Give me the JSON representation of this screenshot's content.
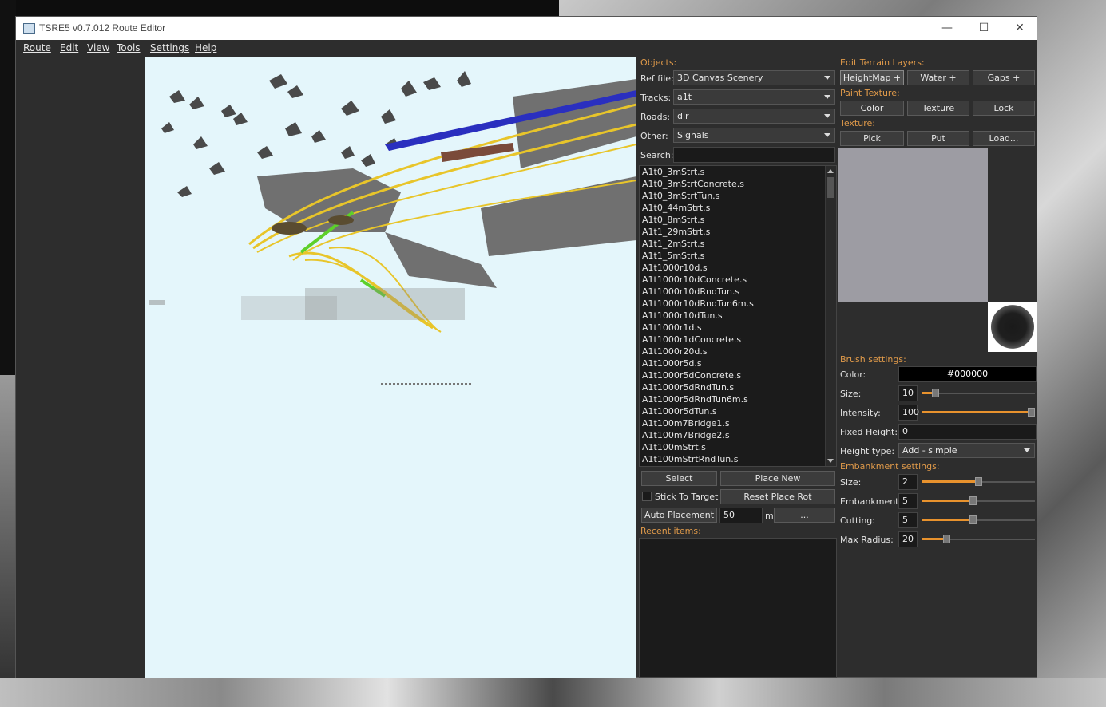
{
  "window": {
    "title": "TSRE5 v0.7.012 Route Editor",
    "minimize": "—",
    "maximize": "☐",
    "close": "✕"
  },
  "menu": [
    "Route",
    "Edit",
    "View",
    "Tools",
    "Settings",
    "Help"
  ],
  "objects": {
    "header": "Objects:",
    "ref_file_label": "Ref file:",
    "ref_file_value": "3D Canvas Scenery",
    "tracks_label": "Tracks:",
    "tracks_value": "a1t",
    "roads_label": "Roads:",
    "roads_value": "dir",
    "other_label": "Other:",
    "other_value": "Signals",
    "search_label": "Search:",
    "search_value": "",
    "items": [
      "A1t0_3mStrt.s",
      "A1t0_3mStrtConcrete.s",
      "A1t0_3mStrtTun.s",
      "A1t0_44mStrt.s",
      "A1t0_8mStrt.s",
      "A1t1_29mStrt.s",
      "A1t1_2mStrt.s",
      "A1t1_5mStrt.s",
      "A1t1000r10d.s",
      "A1t1000r10dConcrete.s",
      "A1t1000r10dRndTun.s",
      "A1t1000r10dRndTun6m.s",
      "A1t1000r10dTun.s",
      "A1t1000r1d.s",
      "A1t1000r1dConcrete.s",
      "A1t1000r20d.s",
      "A1t1000r5d.s",
      "A1t1000r5dConcrete.s",
      "A1t1000r5dRndTun.s",
      "A1t1000r5dRndTun6m.s",
      "A1t1000r5dTun.s",
      "A1t100m7Bridge1.s",
      "A1t100m7Bridge2.s",
      "A1t100mStrt.s",
      "A1t100mStrtRndTun.s"
    ],
    "select_btn": "Select",
    "place_new_btn": "Place New",
    "stick_label": "Stick To Target",
    "reset_rot_btn": "Reset Place Rot",
    "auto_placement_btn": "Auto Placement",
    "auto_value": "50",
    "auto_unit": "m",
    "more_btn": "...",
    "recent_label": "Recent items:"
  },
  "terrain": {
    "header": "Edit Terrain Layers:",
    "heightmap_btn": "HeightMap +",
    "water_btn": "Water +",
    "gaps_btn": "Gaps +",
    "paint_label": "Paint Texture:",
    "color_btn": "Color",
    "texture_btn": "Texture",
    "lock_btn": "Lock",
    "texture_label": "Texture:",
    "pick_btn": "Pick",
    "put_btn": "Put",
    "load_btn": "Load...",
    "brush_header": "Brush settings:",
    "color_label": "Color:",
    "color_value": "#000000",
    "size_label": "Size:",
    "size_value": "10",
    "size_level": 0.1,
    "intensity_label": "Intensity:",
    "intensity_value": "100",
    "intensity_level": 1.0,
    "fixed_height_label": "Fixed Height:",
    "fixed_height_value": "0",
    "height_type_label": "Height type:",
    "height_type_value": "Add - simple",
    "embankment_header": "Embankment settings:",
    "emb_size_label": "Size:",
    "emb_size_value": "2",
    "emb_size_level": 0.5,
    "emb_label": "Embankment:",
    "emb_value": "5",
    "emb_level": 0.45,
    "cut_label": "Cutting:",
    "cut_value": "5",
    "cut_level": 0.45,
    "radius_label": "Max Radius:",
    "radius_value": "20",
    "radius_level": 0.2
  },
  "colors": {
    "accent": "#e8922d",
    "viewport_sky": "#e4f6fb",
    "panel": "#2d2d2d"
  }
}
